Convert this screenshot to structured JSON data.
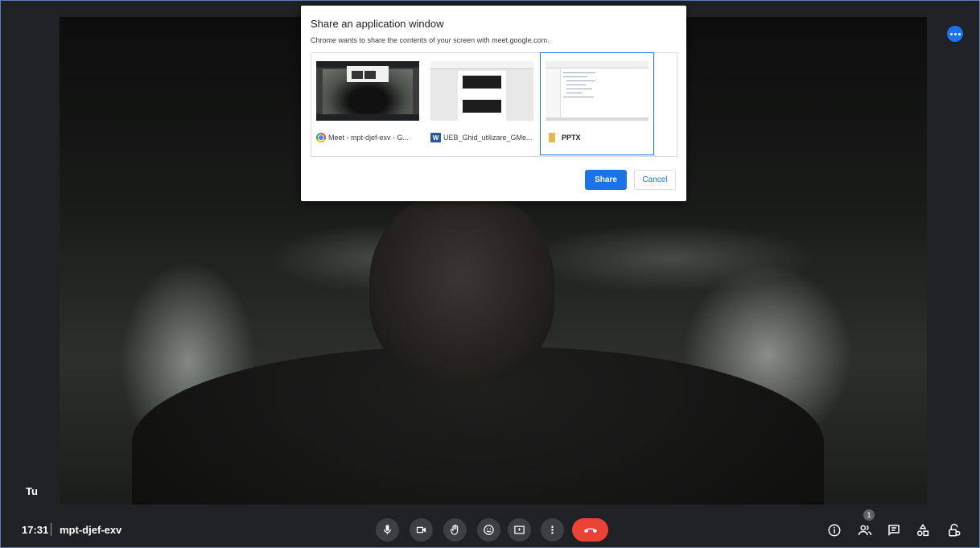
{
  "dialog": {
    "title": "Share an application window",
    "subtitle": "Chrome wants to share the contents of your screen with meet.google.com.",
    "windows": [
      {
        "label": "Meet - mpt-djef-exv - G...",
        "icon": "chrome-icon",
        "selected": false
      },
      {
        "label": "UEB_Ghid_utilizare_GMe...",
        "icon": "word-icon",
        "selected": false
      },
      {
        "label": "PPTX",
        "icon": "folder-icon",
        "selected": true
      }
    ],
    "word_icon_letter": "W",
    "share_label": "Share",
    "cancel_label": "Cancel"
  },
  "video": {
    "self_label": "Tu"
  },
  "bottom_bar": {
    "time": "17:31",
    "meeting_code": "mpt-djef-exv",
    "participant_count": "1",
    "controls": [
      "microphone-icon",
      "camera-icon",
      "raise-hand-icon",
      "emoji-icon",
      "present-icon",
      "more-vert-icon",
      "end-call-icon"
    ],
    "right_controls": [
      "info-icon",
      "people-icon",
      "chat-icon",
      "activities-icon",
      "host-controls-icon"
    ]
  },
  "colors": {
    "accent": "#1a73e8",
    "end_call": "#ea4335",
    "control_bg": "#3c4043",
    "background": "#202124"
  }
}
